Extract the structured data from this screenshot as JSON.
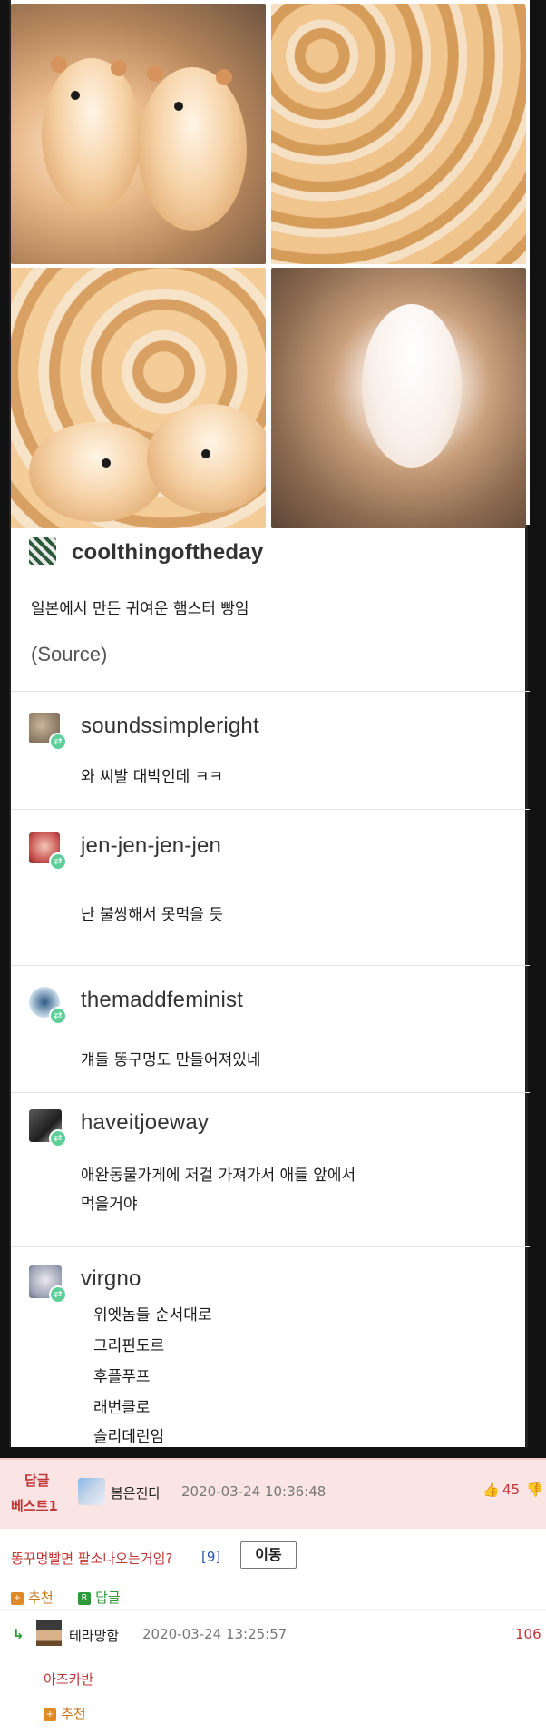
{
  "post": {
    "op": {
      "username": "coolthingoftheday",
      "text": "일본에서 만든 귀여운 햄스터 빵임",
      "source_link": "(Source)"
    },
    "reblogs": [
      {
        "username": "soundssimpleright",
        "lines": [
          "와 씨발 대박인데 ㅋㅋ"
        ]
      },
      {
        "username": "jen-jen-jen-jen",
        "lines": [
          "난 불쌍해서 못먹을 듯"
        ]
      },
      {
        "username": "themaddfeminist",
        "lines": [
          "걔들 똥구멍도 만들어져있네"
        ]
      },
      {
        "username": "haveitjoeway",
        "lines": [
          "애완동물가게에 저걸 가져가서 애들 앞에서",
          "먹을거야"
        ]
      },
      {
        "username": "virgno",
        "lines": [
          "위엣놈들 순서대로",
          "그리핀도르",
          "후플푸프",
          "래번클로",
          "슬리데린임"
        ]
      }
    ]
  },
  "comments": {
    "best": {
      "tag_line1": "답글",
      "tag_line2": "베스트1",
      "author": "봄은진다",
      "timestamp": "2020-03-24 10:36:48",
      "likes": "45",
      "text": "똥꾸멍빨면 팥소나오는거임?",
      "reply_count": "[9]",
      "move_button": "이동",
      "recommend": "추천",
      "reply": "답글"
    },
    "reply": {
      "author": "테라망함",
      "timestamp": "2020-03-24 13:25:57",
      "likes": "106",
      "text": "아즈카반",
      "recommend": "추천"
    }
  },
  "colors": {
    "retweet_green": "#5fcf9a",
    "best_bg": "#fbe4e4",
    "best_red": "#c03535",
    "link_blue": "#2d56a8"
  }
}
